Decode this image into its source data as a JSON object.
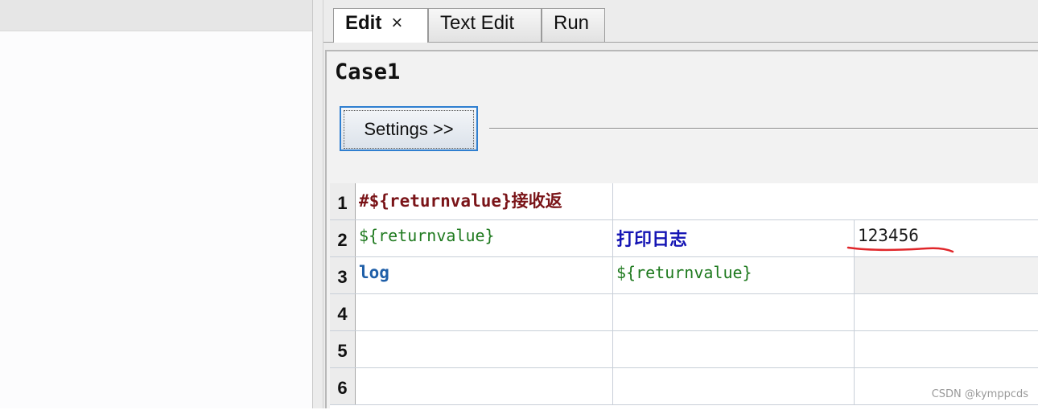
{
  "tabs": [
    {
      "label": "Edit",
      "close_glyph": "×",
      "active": true
    },
    {
      "label": "Text Edit",
      "active": false
    },
    {
      "label": "Run",
      "active": false
    }
  ],
  "editor": {
    "case_title": "Case1",
    "settings_button": "Settings >>"
  },
  "grid": {
    "rows": [
      {
        "num": "1",
        "c1": "#${returnvalue}接收返",
        "c2": "",
        "c3": ""
      },
      {
        "num": "2",
        "c1": "${returnvalue}",
        "c2": "打印日志",
        "c3": "123456"
      },
      {
        "num": "3",
        "c1": "log",
        "c2": "${returnvalue}",
        "c3": ""
      },
      {
        "num": "4",
        "c1": "",
        "c2": "",
        "c3": ""
      },
      {
        "num": "5",
        "c1": "",
        "c2": "",
        "c3": ""
      },
      {
        "num": "6",
        "c1": "",
        "c2": "",
        "c3": ""
      }
    ]
  },
  "annotation": {
    "underline_color": "#e0262a"
  },
  "watermark": "CSDN @kymppcds",
  "colors": {
    "comment": "#7a1418",
    "variable": "#1f7a1f",
    "keyword_cn": "#1515b4",
    "keyword": "#1f5fa8",
    "focus_border": "#2f7fd0"
  }
}
